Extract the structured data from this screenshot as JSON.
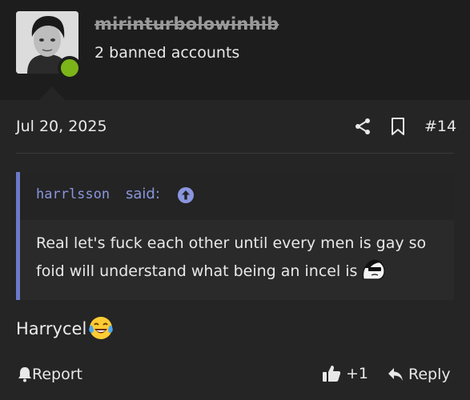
{
  "user": {
    "username": "mirinturbolowinhib",
    "subtitle": "2 banned accounts",
    "online_color": "#7cb518"
  },
  "post": {
    "date": "Jul 20, 2025",
    "number": "#14",
    "icons": [
      "share-icon",
      "bookmark-icon"
    ]
  },
  "quote": {
    "author": "harrlsson",
    "said_label": "said:",
    "text": "Real let's fuck each other until every men is gay so foid will understand what being an incel is",
    "accent_color": "#6b79c9"
  },
  "reply": {
    "text": "Harrycel"
  },
  "actions": {
    "report_label": "Report",
    "like_label": "+1",
    "reply_label": "Reply"
  }
}
